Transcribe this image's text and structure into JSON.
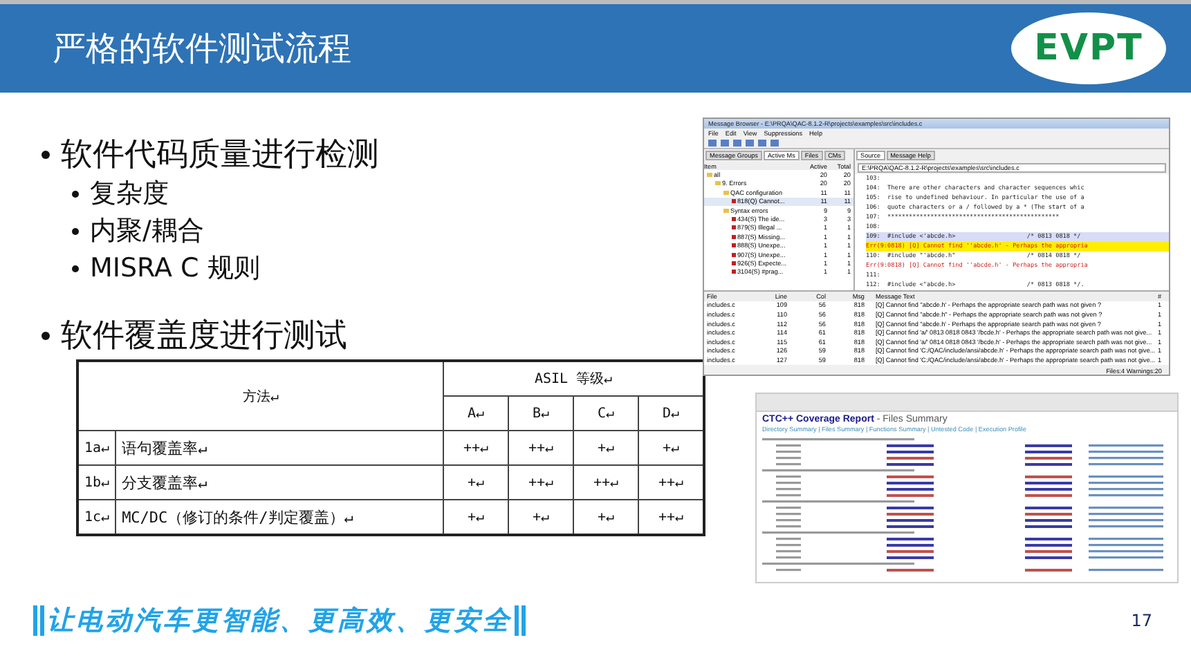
{
  "header": {
    "title": "严格的软件测试流程",
    "logo": "EVPT"
  },
  "bullets": [
    {
      "text": "软件代码质量进行检测",
      "children": [
        {
          "text": "复杂度"
        },
        {
          "text": "内聚/耦合"
        },
        {
          "text": "MISRA C 规则"
        }
      ]
    },
    {
      "text": "软件覆盖度进行测试"
    }
  ],
  "table": {
    "method_header": "方法↵",
    "asil_header": "ASIL 等级↵",
    "levels": [
      "A↵",
      "B↵",
      "C↵",
      "D↵"
    ],
    "rows": [
      {
        "id": "1a↵",
        "method": "语句覆盖率↵",
        "values": [
          "++↵",
          "++↵",
          "+↵",
          "+↵"
        ]
      },
      {
        "id": "1b↵",
        "method": "分支覆盖率↵",
        "values": [
          "+↵",
          "++↵",
          "++↵",
          "++↵"
        ]
      },
      {
        "id": "1c↵",
        "method": "MC/DC（修订的条件/判定覆盖）↵",
        "values": [
          "+↵",
          "+↵",
          "+↵",
          "++↵"
        ]
      }
    ]
  },
  "message_browser": {
    "title": "Message Browser - E:\\PRQA\\QAC-8.1.2-R\\projects\\examples\\src\\includes.c",
    "menu": [
      "File",
      "Edit",
      "View",
      "Suppressions",
      "Help"
    ],
    "left_tabs": [
      {
        "label": "Message Groups",
        "selected": false
      },
      {
        "label": "Active Ms",
        "selected": true
      },
      {
        "label": "Files",
        "selected": false
      },
      {
        "label": "CMs",
        "selected": false
      }
    ],
    "tree_columns": [
      "Item",
      "Active",
      "Total"
    ],
    "tree": [
      {
        "label": "all",
        "active": "20",
        "total": "20",
        "kind": "folder",
        "selected": false,
        "children": [
          {
            "label": "9. Errors",
            "active": "20",
            "total": "20",
            "kind": "folder",
            "selected": false,
            "children": [
              {
                "label": "QAC configuration",
                "active": "11",
                "total": "11",
                "kind": "folder",
                "selected": false,
                "children": [
                  {
                    "label": "818(Q) Cannot...",
                    "active": "11",
                    "total": "11",
                    "kind": "message",
                    "selected": true
                  }
                ]
              },
              {
                "label": "Syntax errors",
                "active": "9",
                "total": "9",
                "kind": "folder",
                "selected": false,
                "children": [
                  {
                    "label": "434(S) The ide...",
                    "active": "3",
                    "total": "3",
                    "kind": "message",
                    "selected": false
                  },
                  {
                    "label": "879(S) Illegal ...",
                    "active": "1",
                    "total": "1",
                    "kind": "message",
                    "selected": false
                  },
                  {
                    "label": "887(S) Missing...",
                    "active": "1",
                    "total": "1",
                    "kind": "message",
                    "selected": false
                  },
                  {
                    "label": "888(S) Unexpe...",
                    "active": "1",
                    "total": "1",
                    "kind": "message",
                    "selected": false
                  },
                  {
                    "label": "907(S) Unexpe...",
                    "active": "1",
                    "total": "1",
                    "kind": "message",
                    "selected": false
                  },
                  {
                    "label": "926(S) Expecte...",
                    "active": "1",
                    "total": "1",
                    "kind": "message",
                    "selected": false
                  },
                  {
                    "label": "3104(S) #prag...",
                    "active": "1",
                    "total": "1",
                    "kind": "message",
                    "selected": false
                  }
                ]
              }
            ]
          }
        ]
      }
    ],
    "right_tabs": [
      {
        "label": "Source",
        "selected": true
      },
      {
        "label": "Message Help",
        "selected": false
      }
    ],
    "path": "E:\\PRQA\\QAC-8.1.2-R\\projects\\examples\\src\\includes.c",
    "code": [
      {
        "kind": "code",
        "text": "103:",
        "selected": false
      },
      {
        "kind": "code",
        "text": "104:  There are other characters and character sequences whic",
        "selected": false
      },
      {
        "kind": "code",
        "text": "105:  rise to undefined behaviour. In particular the use of a",
        "selected": false
      },
      {
        "kind": "code",
        "text": "106:  quote characters or a / followed by a * (The start of a",
        "selected": false
      },
      {
        "kind": "code",
        "text": "107:  ************************************************",
        "selected": false
      },
      {
        "kind": "code",
        "text": "108:",
        "selected": false
      },
      {
        "kind": "code",
        "text": "109:  #include <'abcde.h>                    /* 0813 0818 */",
        "selected": true
      },
      {
        "kind": "error",
        "text": "Err(9:0818) [Q] Cannot find ''abcde.h' - Perhaps the appropria",
        "selected": true
      },
      {
        "kind": "code",
        "text": "110:  #include \"'abcde.h\"                    /* 0814 0818 */",
        "selected": false
      },
      {
        "kind": "error",
        "text": "Err(9:0818) [Q] Cannot find ''abcde.h' - Perhaps the appropria",
        "selected": false
      },
      {
        "kind": "code",
        "text": "111:",
        "selected": false
      },
      {
        "kind": "code",
        "text": "112:  #include <\"abcde.h>                    /* 0813 0818 */.",
        "selected": false
      }
    ],
    "list_columns": [
      "File",
      "Line",
      "Col",
      "Msg",
      "Message Text",
      "#"
    ],
    "list_rows": [
      [
        "includes.c",
        "109",
        "56",
        "818",
        "[Q] Cannot find ''abcde.h' - Perhaps the appropriate search path was not given ?",
        "1"
      ],
      [
        "includes.c",
        "110",
        "56",
        "818",
        "[Q] Cannot find \"abcde.h\" - Perhaps the appropriate search path was not given ?",
        "1"
      ],
      [
        "includes.c",
        "112",
        "56",
        "818",
        "[Q] Cannot find \"abcde.h' - Perhaps the appropriate search path was not given ?",
        "1"
      ],
      [
        "includes.c",
        "114",
        "61",
        "818",
        "[Q] Cannot find 'a/' 0813 0818 0843 '/bcde.h' - Perhaps the appropriate search path was not give...",
        "1"
      ],
      [
        "includes.c",
        "115",
        "61",
        "818",
        "[Q] Cannot find 'a/' 0814 0818 0843 '/bcde.h' - Perhaps the appropriate search path was not give...",
        "1"
      ],
      [
        "includes.c",
        "126",
        "59",
        "818",
        "[Q] Cannot find 'C:/QAC/include/ansi/abcde.h' - Perhaps the appropriate search path was not give...",
        "1"
      ],
      [
        "includes.c",
        "127",
        "59",
        "818",
        "[Q] Cannot find 'C:/QAC/include/ansi/abcde.h' - Perhaps the appropriate search path was not give...",
        "1"
      ]
    ],
    "status": "Files:4 Warnings:20"
  },
  "coverage_report": {
    "title": "CTC++ Coverage Report",
    "subtitle": " - Files Summary",
    "nav": "Directory Summary | Files Summary | Functions Summary | Untested Code | Execution Profile"
  },
  "footer": {
    "slogan": "让电动汽车更智能、更高效、更安全",
    "page": "17"
  }
}
